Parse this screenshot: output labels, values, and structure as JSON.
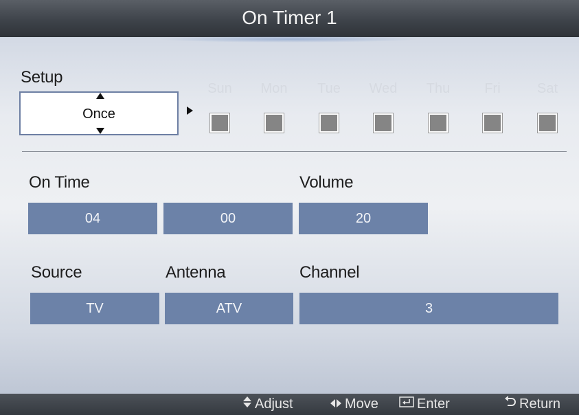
{
  "title": "On Timer 1",
  "setup": {
    "label": "Setup",
    "value": "Once",
    "days": [
      "Sun",
      "Mon",
      "Tue",
      "Wed",
      "Thu",
      "Fri",
      "Sat"
    ]
  },
  "on_time": {
    "label": "On Time",
    "hour": "04",
    "minute": "00"
  },
  "volume": {
    "label": "Volume",
    "value": "20"
  },
  "source": {
    "label": "Source",
    "value": "TV"
  },
  "antenna": {
    "label": "Antenna",
    "value": "ATV"
  },
  "channel": {
    "label": "Channel",
    "value": "3"
  },
  "footer": {
    "adjust": "Adjust",
    "move": "Move",
    "enter": "Enter",
    "return": "Return"
  },
  "colors": {
    "field_bg": "#6c82a8",
    "title_bar": "#3e434a",
    "day_label": "#d6dae1"
  }
}
